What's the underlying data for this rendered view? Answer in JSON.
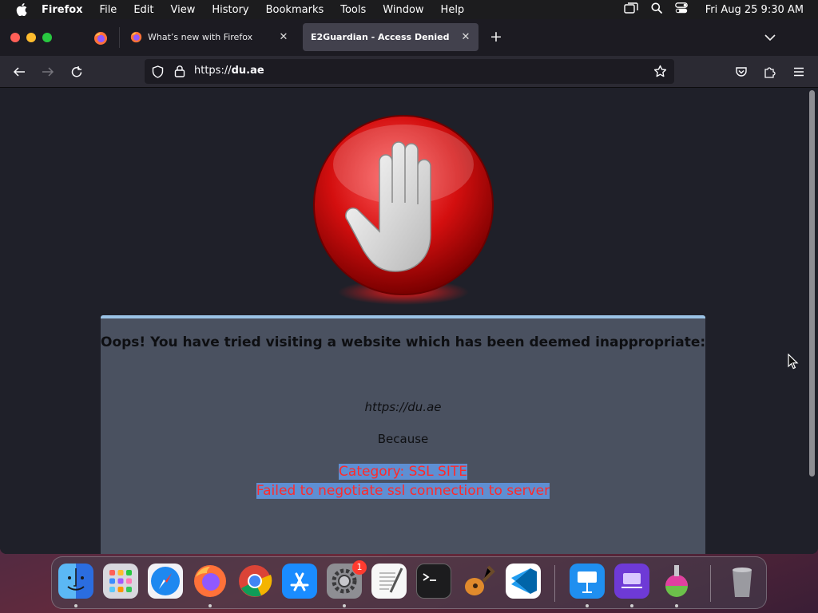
{
  "menubar": {
    "app": "Firefox",
    "items": [
      "File",
      "Edit",
      "View",
      "History",
      "Bookmarks",
      "Tools",
      "Window",
      "Help"
    ],
    "clock": "Fri Aug 25  9:30 AM"
  },
  "tabs": [
    {
      "title": "What’s new with Firefox",
      "active": false
    },
    {
      "title": "E2Guardian - Access Denied",
      "active": true
    }
  ],
  "urlbar": {
    "scheme": "https://",
    "host": "du.ae"
  },
  "page": {
    "heading": "Oops! You have tried visiting a website which has been deemed inappropriate:",
    "site": "https://du.ae",
    "because": "Because",
    "reason_line1": "Category: SSL SITE",
    "reason_line2": "Failed to negotiate ssl connection to server"
  },
  "dock": {
    "apps": [
      "Finder",
      "Launchpad",
      "Safari",
      "Firefox",
      "Google Chrome",
      "App Store",
      "System Settings",
      "TextEdit",
      "Terminal",
      "GarageBand",
      "Visual Studio Code",
      "Keynote",
      "Simulator",
      "Instruments",
      "Trash"
    ],
    "settings_badge": "1"
  },
  "colors": {
    "accent_red": "#ff2a2a",
    "panel_border": "#9bc3e6",
    "selection": "#5e8fd3"
  }
}
